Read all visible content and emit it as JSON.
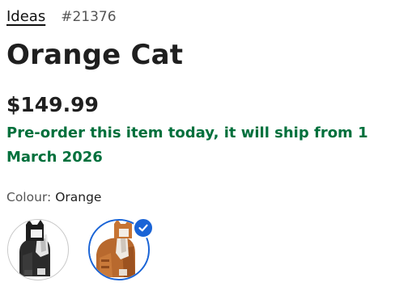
{
  "breadcrumb": {
    "theme_label": "Ideas",
    "item_number": "#21376"
  },
  "product": {
    "title": "Orange Cat",
    "price": "$149.99",
    "preorder_message": "Pre-order this item today, it will ship from 1 March 2026"
  },
  "colour": {
    "label": "Colour:",
    "selected": "Orange",
    "options": [
      {
        "name": "Black",
        "selected": false
      },
      {
        "name": "Orange",
        "selected": true
      }
    ]
  },
  "colors": {
    "preorder_green": "#00703c",
    "selection_blue": "#1a64d6"
  },
  "icons": {
    "selected_check": "check-icon"
  }
}
